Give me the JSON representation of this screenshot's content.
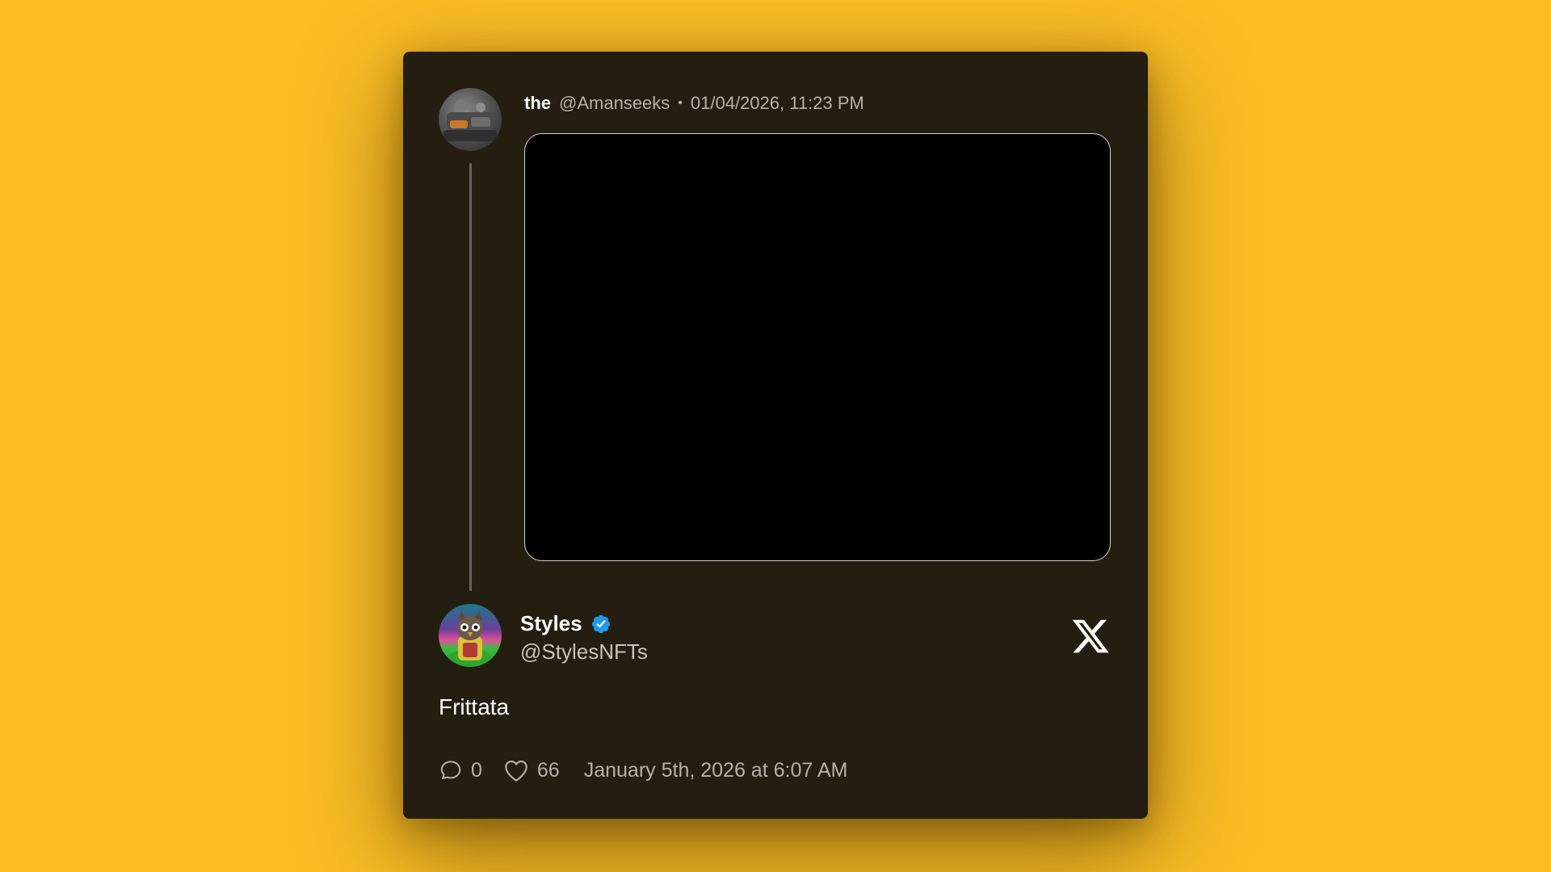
{
  "parent_tweet": {
    "display_name": "the",
    "handle": "@Amanseeks",
    "separator": "•",
    "timestamp": "01/04/2026, 11:23 PM"
  },
  "tweet": {
    "display_name": "Styles",
    "handle": "@StylesNFTs",
    "text": "Frittata",
    "replies": "0",
    "likes": "66",
    "date": "January 5th, 2026 at 6:07 AM"
  },
  "icons": {
    "platform": "x-logo-icon",
    "verified": "verified-badge-icon",
    "replies": "comment-bubble-icon",
    "likes": "heart-icon"
  },
  "colors": {
    "background": "#FABD24",
    "card": "#231E10",
    "verified": "#1D9BF0",
    "text_primary": "#FFFFFF",
    "text_secondary": "#B6B1A7"
  }
}
